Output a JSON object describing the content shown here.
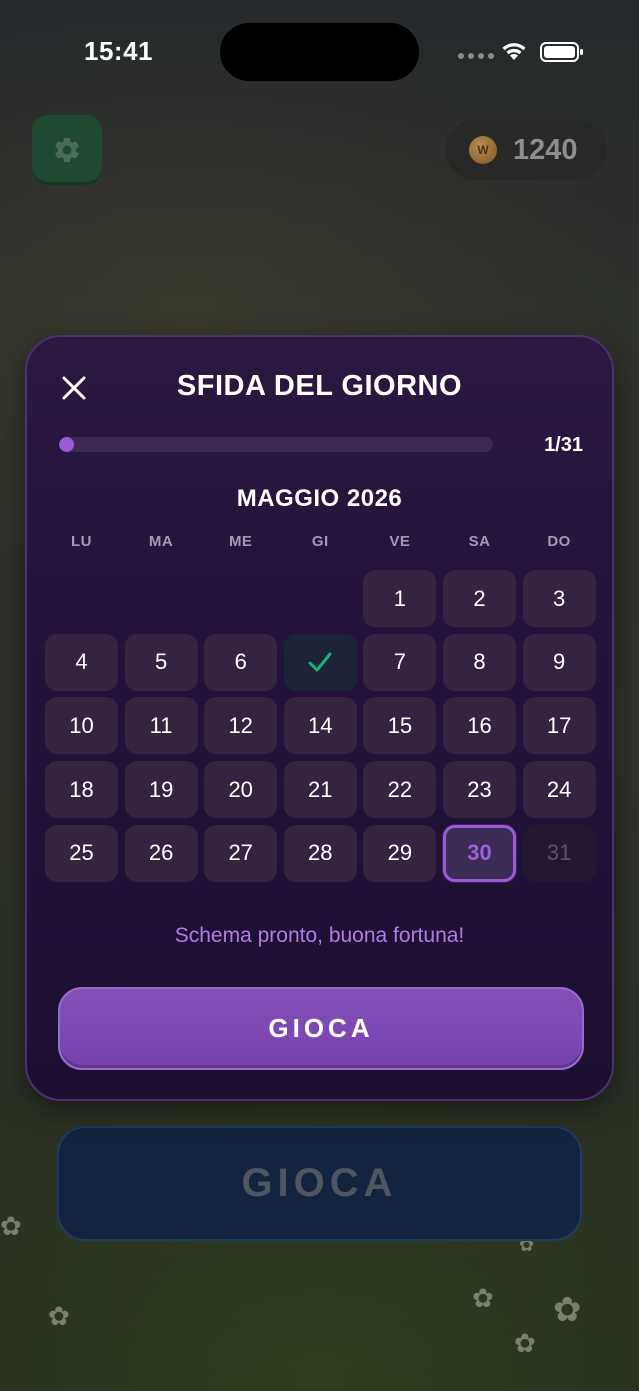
{
  "status_bar": {
    "time": "15:41"
  },
  "header": {
    "settings_icon": "gear-icon",
    "coins": "1240",
    "coin_icon_letter": "W"
  },
  "modal": {
    "title": "SFIDA DEL GIORNO",
    "progress": {
      "label": "1/31",
      "value": 1,
      "total": 31
    },
    "month": "MAGGIO 2026",
    "weekdays": [
      "LU",
      "MA",
      "ME",
      "GI",
      "VE",
      "SA",
      "DO"
    ],
    "first_weekday_index": 4,
    "days": [
      {
        "label": "1",
        "state": "available"
      },
      {
        "label": "2",
        "state": "available"
      },
      {
        "label": "3",
        "state": "available"
      },
      {
        "label": "4",
        "state": "available"
      },
      {
        "label": "5",
        "state": "available"
      },
      {
        "label": "6",
        "state": "available"
      },
      {
        "label": "",
        "state": "completed",
        "icon": "checkmark-icon"
      },
      {
        "label": "7",
        "state": "available"
      },
      {
        "label": "8",
        "state": "available"
      },
      {
        "label": "9",
        "state": "available"
      },
      {
        "label": "10",
        "state": "available"
      },
      {
        "label": "11",
        "state": "available"
      },
      {
        "label": "12",
        "state": "available"
      },
      {
        "label": "14",
        "state": "available"
      },
      {
        "label": "15",
        "state": "available"
      },
      {
        "label": "16",
        "state": "available"
      },
      {
        "label": "17",
        "state": "available"
      },
      {
        "label": "18",
        "state": "available"
      },
      {
        "label": "19",
        "state": "available"
      },
      {
        "label": "20",
        "state": "available"
      },
      {
        "label": "21",
        "state": "available"
      },
      {
        "label": "22",
        "state": "available"
      },
      {
        "label": "23",
        "state": "available"
      },
      {
        "label": "24",
        "state": "available"
      },
      {
        "label": "25",
        "state": "available"
      },
      {
        "label": "26",
        "state": "available"
      },
      {
        "label": "27",
        "state": "available"
      },
      {
        "label": "28",
        "state": "available"
      },
      {
        "label": "29",
        "state": "available"
      },
      {
        "label": "30",
        "state": "today"
      },
      {
        "label": "31",
        "state": "locked"
      }
    ],
    "hint": "Schema pronto, buona fortuna!",
    "play_label": "GIOCA"
  },
  "background": {
    "play_label": "GIOCA"
  },
  "colors": {
    "accent": "#9b5bd6",
    "check": "#1fae7c",
    "modal_bg": "#22123a"
  }
}
